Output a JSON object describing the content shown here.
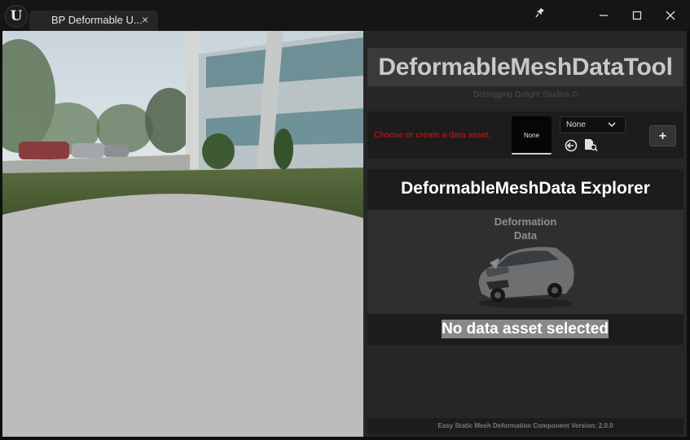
{
  "window": {
    "tab_title": "BP Deformable U...",
    "tab_close": "×",
    "app_logo": "U",
    "icons": [
      "unreal-logo",
      "pin-icon",
      "minimize-icon",
      "maximize-icon",
      "close-icon"
    ]
  },
  "panel": {
    "title": "DeformableMeshDataTool",
    "subtitle": "Debugging Delight Studios ©",
    "asset_prompt": "Choose or create a data asset:",
    "asset_thumbnail_text": "None",
    "asset_dropdown_value": "None",
    "add_button_label": "+",
    "explorer_title": "DeformableMeshData Explorer",
    "explorer_image_caption": [
      "Deformation",
      "Data"
    ],
    "no_selection_text": "No data asset selected",
    "footer": "Easy Static Mesh Deformation Component Version: 2.0.0"
  },
  "colors": {
    "prompt_red": "#dd1111",
    "panel_bg": "#262626",
    "title_bg": "#3a3a3a",
    "no_selection_bg": "#888888"
  }
}
